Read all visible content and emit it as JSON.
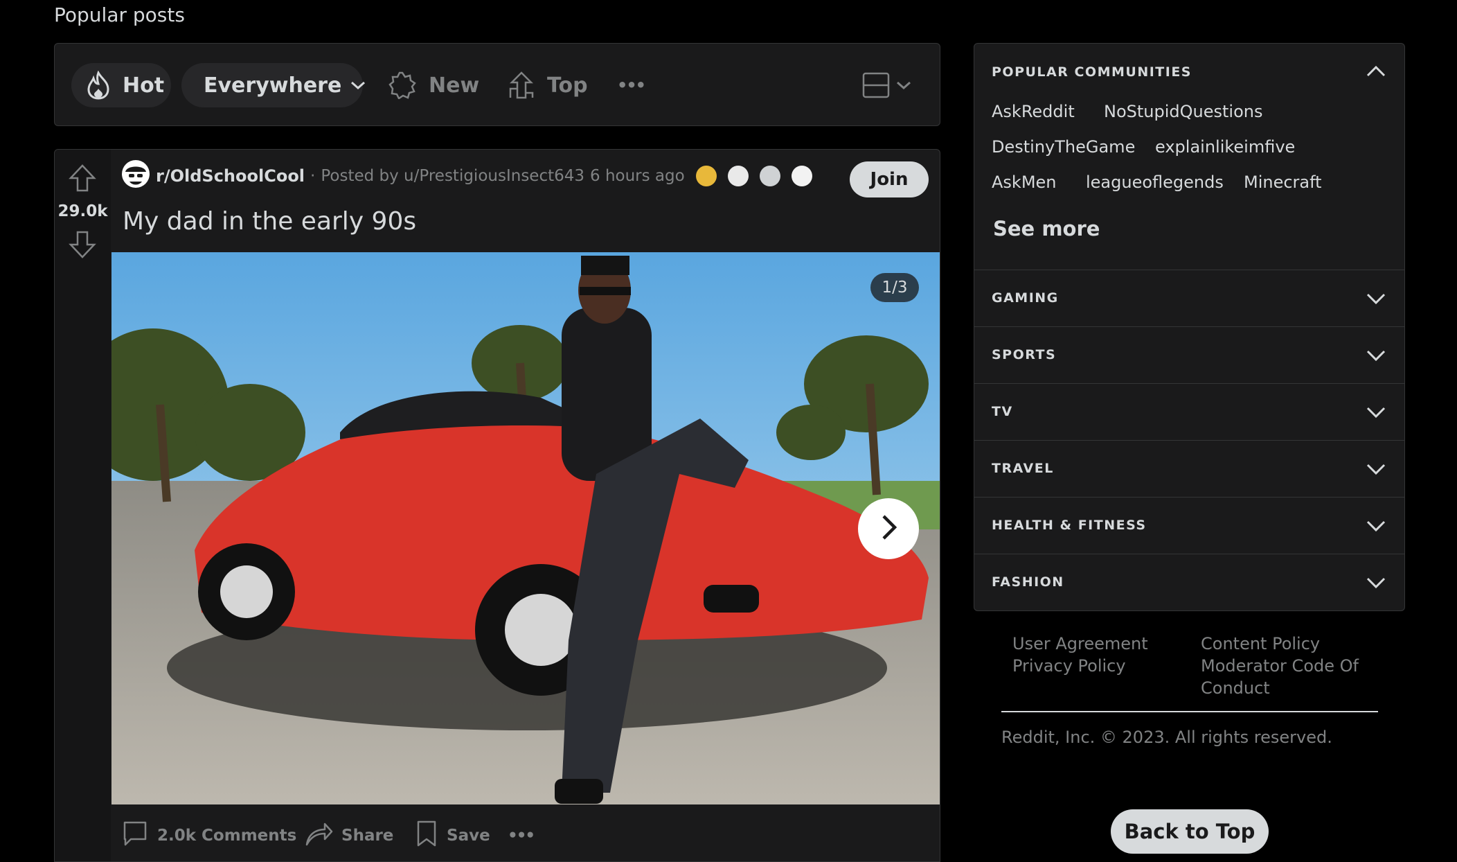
{
  "page": {
    "heading": "Popular posts"
  },
  "sort_bar": {
    "hot_label": "Hot",
    "location_label": "Everywhere",
    "new_label": "New",
    "top_label": "Top",
    "more_label": "•••"
  },
  "post": {
    "vote_count": "29.0k",
    "subreddit": "r/OldSchoolCool",
    "posted_by": "Posted by u/PrestigiousInsect643",
    "time_ago": "6 hours ago",
    "join_label": "Join",
    "title": "My dad in the early 90s",
    "gallery_counter": "1/3",
    "actions": {
      "comments": "2.0k Comments",
      "share": "Share",
      "save": "Save",
      "more": "•••"
    }
  },
  "sidebar": {
    "popular_title": "POPULAR COMMUNITIES",
    "communities": [
      "AskReddit",
      "NoStupidQuestions",
      "DestinyTheGame",
      "explainlikeimfive",
      "AskMen",
      "leagueoflegends",
      "Minecraft"
    ],
    "see_more": "See more",
    "categories": [
      "GAMING",
      "SPORTS",
      "TV",
      "TRAVEL",
      "HEALTH & FITNESS",
      "FASHION"
    ]
  },
  "footer": {
    "user_agreement": "User Agreement",
    "privacy_policy": "Privacy Policy",
    "content_policy": "Content Policy",
    "moderator_code": "Moderator Code Of Conduct",
    "copyright": "Reddit, Inc. © 2023. All rights reserved."
  },
  "back_to_top": "Back to Top",
  "colors": {
    "background": "#000000",
    "card": "#1a1a1b",
    "border": "#343536",
    "text": "#d7dadc",
    "muted": "#818384",
    "pill": "#272729"
  }
}
